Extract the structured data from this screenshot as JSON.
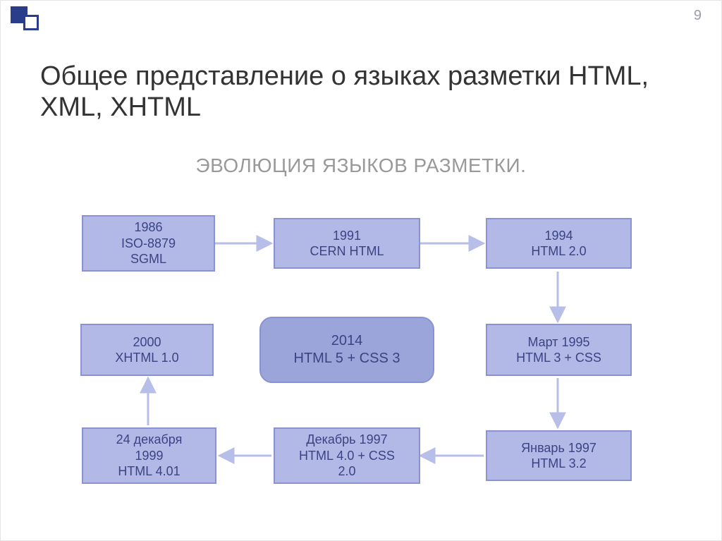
{
  "page_number": "9",
  "title": "Общее представление о языках разметки HTML, XML, XHTML",
  "subtitle": "ЭВОЛЮЦИЯ ЯЗЫКОВ РАЗМЕТКИ.",
  "nodes": {
    "n1": {
      "line1": "1986",
      "line2": "ISO-8879",
      "line3": "SGML"
    },
    "n2": {
      "line1": "1991",
      "line2": "CERN HTML",
      "line3": ""
    },
    "n3": {
      "line1": "1994",
      "line2": "HTML 2.0",
      "line3": ""
    },
    "n4": {
      "line1": "Март 1995",
      "line2": "HTML 3 +   CSS",
      "line3": ""
    },
    "n5": {
      "line1": "Январь 1997",
      "line2": "HTML 3.2",
      "line3": ""
    },
    "n6": {
      "line1": "Декабрь 1997",
      "line2": "HTML 4.0 + CSS",
      "line3": "2.0"
    },
    "n7": {
      "line1": "24 декабря",
      "line2": "1999",
      "line3": "HTML 4.01"
    },
    "n8": {
      "line1": "2000",
      "line2": "XHTML 1.0",
      "line3": ""
    },
    "n9": {
      "line1": "2014",
      "line2": "HTML 5 + CSS 3",
      "line3": ""
    }
  },
  "colors": {
    "box_fill": "#b2b9e6",
    "box_border": "#8893d0",
    "arrow": "#b7bee7",
    "text": "#3c4384"
  },
  "chart_data": {
    "type": "diagram",
    "title": "ЭВОЛЮЦИЯ ЯЗЫКОВ РАЗМЕТКИ.",
    "nodes": [
      {
        "id": "n1",
        "label": "1986 ISO-8879 SGML"
      },
      {
        "id": "n2",
        "label": "1991 CERN HTML"
      },
      {
        "id": "n3",
        "label": "1994 HTML 2.0"
      },
      {
        "id": "n4",
        "label": "Март 1995 HTML 3 + CSS"
      },
      {
        "id": "n5",
        "label": "Январь 1997 HTML 3.2"
      },
      {
        "id": "n6",
        "label": "Декабрь 1997 HTML 4.0 + CSS 2.0"
      },
      {
        "id": "n7",
        "label": "24 декабря 1999 HTML 4.01"
      },
      {
        "id": "n8",
        "label": "2000 XHTML 1.0"
      },
      {
        "id": "n9",
        "label": "2014 HTML 5 + CSS 3",
        "terminal": true
      }
    ],
    "edges": [
      {
        "from": "n1",
        "to": "n2"
      },
      {
        "from": "n2",
        "to": "n3"
      },
      {
        "from": "n3",
        "to": "n4"
      },
      {
        "from": "n4",
        "to": "n5"
      },
      {
        "from": "n5",
        "to": "n6"
      },
      {
        "from": "n6",
        "to": "n7"
      },
      {
        "from": "n7",
        "to": "n8"
      }
    ]
  }
}
